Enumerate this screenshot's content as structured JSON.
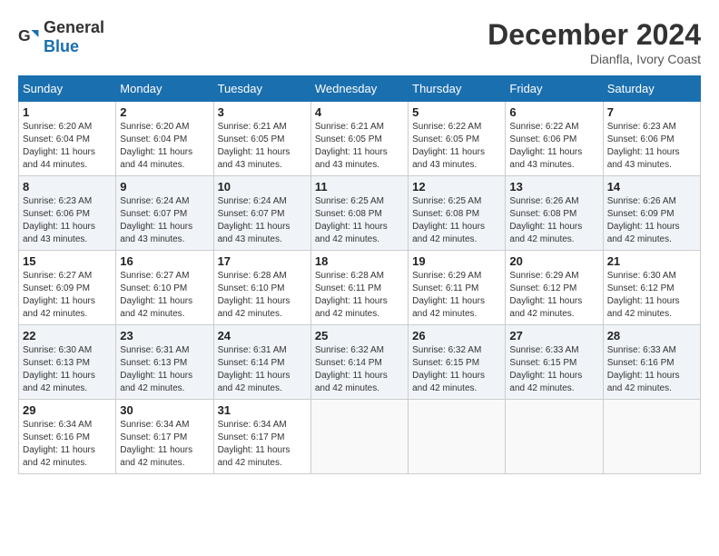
{
  "logo": {
    "general": "General",
    "blue": "Blue"
  },
  "title": "December 2024",
  "location": "Dianfla, Ivory Coast",
  "days_of_week": [
    "Sunday",
    "Monday",
    "Tuesday",
    "Wednesday",
    "Thursday",
    "Friday",
    "Saturday"
  ],
  "weeks": [
    [
      {
        "day": 1,
        "sunrise": "6:20 AM",
        "sunset": "6:04 PM",
        "daylight": "11 hours and 44 minutes."
      },
      {
        "day": 2,
        "sunrise": "6:20 AM",
        "sunset": "6:04 PM",
        "daylight": "11 hours and 44 minutes."
      },
      {
        "day": 3,
        "sunrise": "6:21 AM",
        "sunset": "6:05 PM",
        "daylight": "11 hours and 43 minutes."
      },
      {
        "day": 4,
        "sunrise": "6:21 AM",
        "sunset": "6:05 PM",
        "daylight": "11 hours and 43 minutes."
      },
      {
        "day": 5,
        "sunrise": "6:22 AM",
        "sunset": "6:05 PM",
        "daylight": "11 hours and 43 minutes."
      },
      {
        "day": 6,
        "sunrise": "6:22 AM",
        "sunset": "6:06 PM",
        "daylight": "11 hours and 43 minutes."
      },
      {
        "day": 7,
        "sunrise": "6:23 AM",
        "sunset": "6:06 PM",
        "daylight": "11 hours and 43 minutes."
      }
    ],
    [
      {
        "day": 8,
        "sunrise": "6:23 AM",
        "sunset": "6:06 PM",
        "daylight": "11 hours and 43 minutes."
      },
      {
        "day": 9,
        "sunrise": "6:24 AM",
        "sunset": "6:07 PM",
        "daylight": "11 hours and 43 minutes."
      },
      {
        "day": 10,
        "sunrise": "6:24 AM",
        "sunset": "6:07 PM",
        "daylight": "11 hours and 43 minutes."
      },
      {
        "day": 11,
        "sunrise": "6:25 AM",
        "sunset": "6:08 PM",
        "daylight": "11 hours and 42 minutes."
      },
      {
        "day": 12,
        "sunrise": "6:25 AM",
        "sunset": "6:08 PM",
        "daylight": "11 hours and 42 minutes."
      },
      {
        "day": 13,
        "sunrise": "6:26 AM",
        "sunset": "6:08 PM",
        "daylight": "11 hours and 42 minutes."
      },
      {
        "day": 14,
        "sunrise": "6:26 AM",
        "sunset": "6:09 PM",
        "daylight": "11 hours and 42 minutes."
      }
    ],
    [
      {
        "day": 15,
        "sunrise": "6:27 AM",
        "sunset": "6:09 PM",
        "daylight": "11 hours and 42 minutes."
      },
      {
        "day": 16,
        "sunrise": "6:27 AM",
        "sunset": "6:10 PM",
        "daylight": "11 hours and 42 minutes."
      },
      {
        "day": 17,
        "sunrise": "6:28 AM",
        "sunset": "6:10 PM",
        "daylight": "11 hours and 42 minutes."
      },
      {
        "day": 18,
        "sunrise": "6:28 AM",
        "sunset": "6:11 PM",
        "daylight": "11 hours and 42 minutes."
      },
      {
        "day": 19,
        "sunrise": "6:29 AM",
        "sunset": "6:11 PM",
        "daylight": "11 hours and 42 minutes."
      },
      {
        "day": 20,
        "sunrise": "6:29 AM",
        "sunset": "6:12 PM",
        "daylight": "11 hours and 42 minutes."
      },
      {
        "day": 21,
        "sunrise": "6:30 AM",
        "sunset": "6:12 PM",
        "daylight": "11 hours and 42 minutes."
      }
    ],
    [
      {
        "day": 22,
        "sunrise": "6:30 AM",
        "sunset": "6:13 PM",
        "daylight": "11 hours and 42 minutes."
      },
      {
        "day": 23,
        "sunrise": "6:31 AM",
        "sunset": "6:13 PM",
        "daylight": "11 hours and 42 minutes."
      },
      {
        "day": 24,
        "sunrise": "6:31 AM",
        "sunset": "6:14 PM",
        "daylight": "11 hours and 42 minutes."
      },
      {
        "day": 25,
        "sunrise": "6:32 AM",
        "sunset": "6:14 PM",
        "daylight": "11 hours and 42 minutes."
      },
      {
        "day": 26,
        "sunrise": "6:32 AM",
        "sunset": "6:15 PM",
        "daylight": "11 hours and 42 minutes."
      },
      {
        "day": 27,
        "sunrise": "6:33 AM",
        "sunset": "6:15 PM",
        "daylight": "11 hours and 42 minutes."
      },
      {
        "day": 28,
        "sunrise": "6:33 AM",
        "sunset": "6:16 PM",
        "daylight": "11 hours and 42 minutes."
      }
    ],
    [
      {
        "day": 29,
        "sunrise": "6:34 AM",
        "sunset": "6:16 PM",
        "daylight": "11 hours and 42 minutes."
      },
      {
        "day": 30,
        "sunrise": "6:34 AM",
        "sunset": "6:17 PM",
        "daylight": "11 hours and 42 minutes."
      },
      {
        "day": 31,
        "sunrise": "6:34 AM",
        "sunset": "6:17 PM",
        "daylight": "11 hours and 42 minutes."
      },
      null,
      null,
      null,
      null
    ]
  ],
  "labels": {
    "sunrise": "Sunrise:",
    "sunset": "Sunset:",
    "daylight": "Daylight:"
  }
}
